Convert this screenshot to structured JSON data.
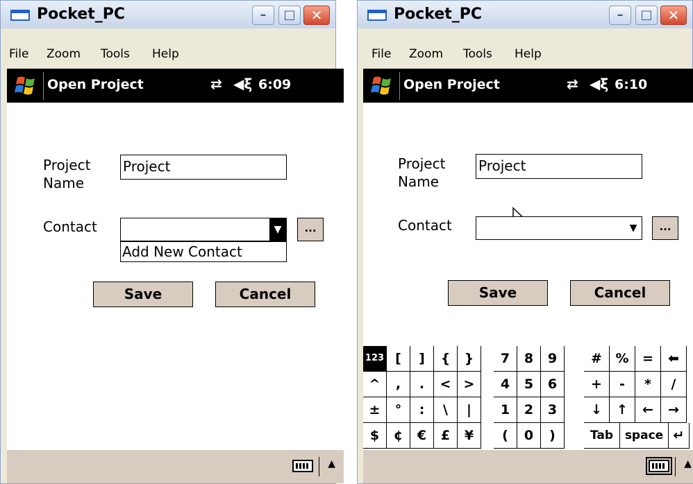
{
  "windows": [
    {
      "title": "Pocket_PC",
      "menu": [
        "File",
        "Zoom",
        "Tools",
        "Help"
      ],
      "nav": {
        "title": "Open Project",
        "time": "6:09",
        "conn_icon": "⇄",
        "vol_icon": "◀ξ"
      },
      "form": {
        "project_label_1": "Project",
        "project_label_2": "Name",
        "project_value": "Project",
        "contact_label": "Contact",
        "contact_value": "",
        "dropdown_item": "Add New Contact",
        "ellipsis": "...",
        "save": "Save",
        "cancel": "Cancel"
      }
    },
    {
      "title": "Pocket_PC",
      "menu": [
        "File",
        "Zoom",
        "Tools",
        "Help"
      ],
      "nav": {
        "title": "Open Project",
        "time": "6:10",
        "conn_icon": "⇄",
        "vol_icon": "◀ξ"
      },
      "form": {
        "project_label_1": "Project",
        "project_label_2": "Name",
        "project_value": "Project",
        "contact_label": "Contact",
        "contact_value": "",
        "ellipsis": "...",
        "save": "Save",
        "cancel": "Cancel"
      },
      "keyboard": {
        "rows": [
          [
            "123",
            "[",
            "]",
            "{",
            "}",
            "7",
            "8",
            "9",
            "#",
            "%",
            "=",
            "⬅"
          ],
          [
            "^",
            ",",
            ".",
            "<",
            ">",
            "4",
            "5",
            "6",
            "+",
            "-",
            "*",
            "/"
          ],
          [
            "±",
            "°",
            ":",
            "\\",
            "|",
            "1",
            "2",
            "3",
            "↓",
            "↑",
            "←",
            "→"
          ],
          [
            "$",
            "¢",
            "€",
            "£",
            "¥",
            "(",
            "0",
            ")",
            "Tab",
            "space",
            "↵"
          ]
        ]
      }
    }
  ],
  "controls": {
    "min": "–",
    "max": "□",
    "close": "✕",
    "sip_arrow": "▲",
    "combo_arrow": "▼"
  }
}
